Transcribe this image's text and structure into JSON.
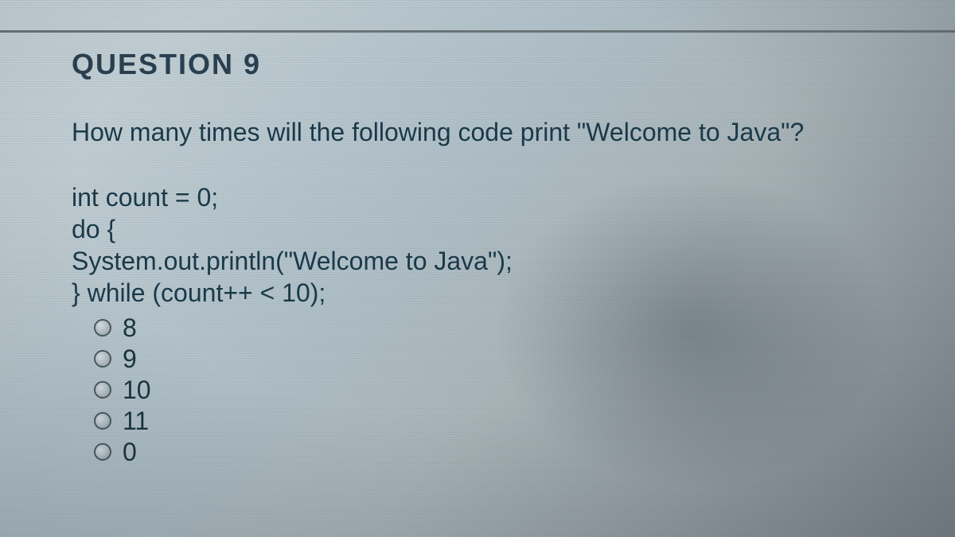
{
  "heading": "QUESTION 9",
  "prompt": "How many times will the following code print \"Welcome to Java\"?",
  "code": {
    "line1": "int count = 0;",
    "line2": "do {",
    "line3": "System.out.println(\"Welcome to Java\");",
    "line4": "} while (count++ < 10);"
  },
  "options": [
    {
      "label": "8"
    },
    {
      "label": "9"
    },
    {
      "label": "10"
    },
    {
      "label": "11"
    },
    {
      "label": "0"
    }
  ]
}
